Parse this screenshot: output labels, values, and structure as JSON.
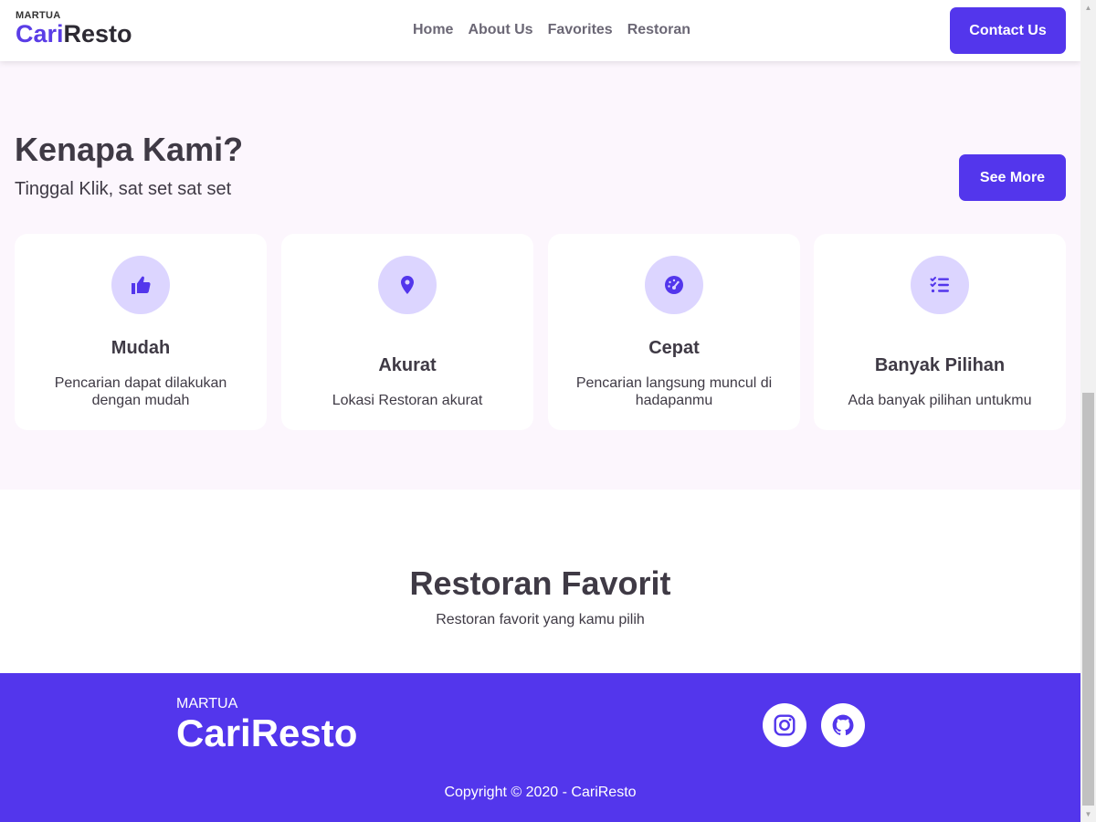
{
  "navbar": {
    "brand_small": "MARTUA",
    "brand_cari": "Cari",
    "brand_resto": "Resto",
    "links": [
      "Home",
      "About Us",
      "Favorites",
      "Restoran"
    ],
    "contact_label": "Contact Us"
  },
  "why": {
    "title": "Kenapa Kami?",
    "subtitle": "Tinggal Klik, sat set sat set",
    "see_more_label": "See More",
    "cards": [
      {
        "icon": "thumbs-up-icon",
        "title": "Mudah",
        "desc": "Pencarian dapat dilakukan dengan mudah"
      },
      {
        "icon": "location-pin-icon",
        "title": "Akurat",
        "desc": "Lokasi Restoran akurat"
      },
      {
        "icon": "speedometer-icon",
        "title": "Cepat",
        "desc": "Pencarian langsung muncul di hadapanmu"
      },
      {
        "icon": "checklist-icon",
        "title": "Banyak Pilihan",
        "desc": "Ada banyak pilihan untukmu"
      }
    ]
  },
  "favorites": {
    "title": "Restoran Favorit",
    "subtitle": "Restoran favorit yang kamu pilih"
  },
  "footer": {
    "brand_small": "MARTUA",
    "brand_big": "CariResto",
    "social": [
      "instagram-icon",
      "github-icon"
    ],
    "copyright": "Copyright © 2020 - CariResto"
  },
  "colors": {
    "primary": "#5336EC",
    "icon_bg": "#DCD5FF",
    "section_bg": "#FCF6FD",
    "text": "#3F3A45"
  }
}
